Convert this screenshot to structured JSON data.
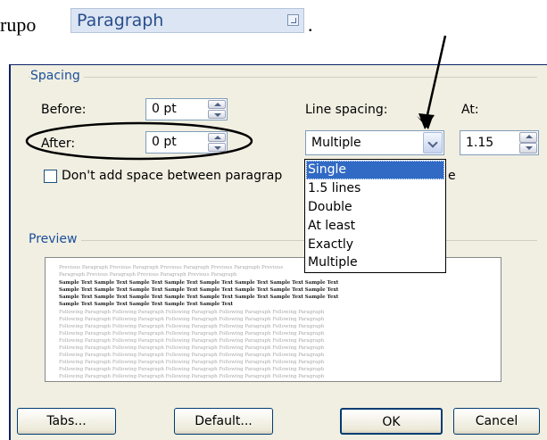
{
  "caption": {
    "prefix": "rupo",
    "group_name": "Paragraph",
    "suffix": "."
  },
  "spacing": {
    "title": "Spacing",
    "before_label": "Before:",
    "before_value": "0 pt",
    "after_label": "After:",
    "after_value": "0 pt",
    "line_spacing_label": "Line spacing:",
    "line_spacing_value": "Multiple",
    "at_label": "At:",
    "at_value": "1.15",
    "dont_add_label": "Don't add space between paragrap",
    "dont_add_tail": "e",
    "dont_add_checked": false
  },
  "line_spacing_options": [
    {
      "label": "Single",
      "selected": true
    },
    {
      "label": "1.5 lines",
      "selected": false
    },
    {
      "label": "Double",
      "selected": false
    },
    {
      "label": "At least",
      "selected": false
    },
    {
      "label": "Exactly",
      "selected": false
    },
    {
      "label": "Multiple",
      "selected": false
    }
  ],
  "preview": {
    "title": "Preview",
    "previous_text": "Previous Paragraph Previous Paragraph Previous Paragraph Previous Paragraph Previous",
    "previous_text_2": "Paragraph Previous Paragraph Previous Paragraph Previous Paragraph",
    "sample_text": "Sample Text Sample Text Sample Text Sample Text Sample Text Sample Text Sample Text Sample Text",
    "sample_text_last": "Sample Text Sample Text Sample Text Sample Text Sample Text",
    "following_text": "Following Paragraph Following Paragraph Following Paragraph Following Paragraph Following Paragraph"
  },
  "buttons": {
    "tabs": "Tabs...",
    "default": "Default...",
    "ok": "OK",
    "cancel": "Cancel"
  },
  "colors": {
    "group_title": "#1b4f9b",
    "dialog_bg": "#f1efe2",
    "selection": "#316ac5",
    "chip_bg": "#dbe5f3"
  }
}
